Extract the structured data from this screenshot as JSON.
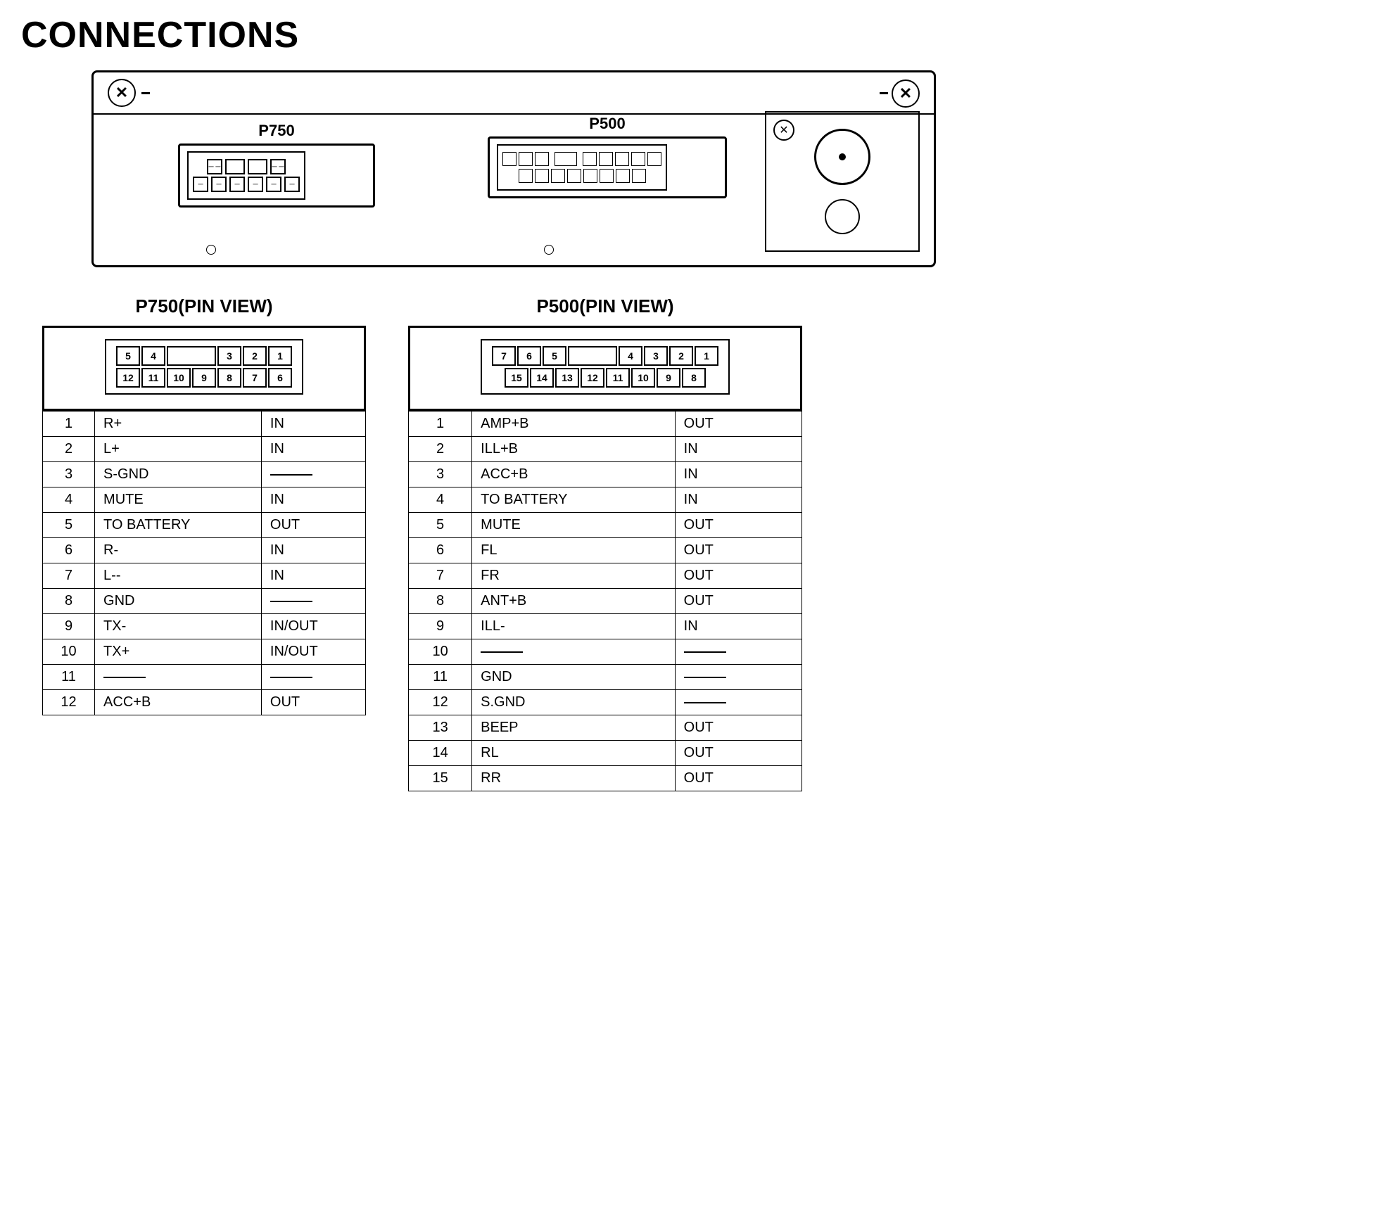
{
  "page": {
    "title": "CONNECTIONS"
  },
  "device": {
    "connector_p750_label": "P750",
    "connector_p500_label": "P500"
  },
  "p750_pin_view": {
    "title": "P750(PIN VIEW)",
    "row1": [
      "5",
      "4",
      "",
      "3",
      "2",
      "1"
    ],
    "row2": [
      "12",
      "11",
      "10",
      "9",
      "8",
      "7",
      "6"
    ]
  },
  "p500_pin_view": {
    "title": "P500(PIN VIEW)",
    "row1": [
      "7",
      "6",
      "5",
      "",
      "4",
      "3",
      "2",
      "1"
    ],
    "row2": [
      "15",
      "14",
      "13",
      "12",
      "11",
      "10",
      "9",
      "8"
    ]
  },
  "p750_pins": [
    {
      "pin": "1",
      "signal": "R+",
      "dir": "IN"
    },
    {
      "pin": "2",
      "signal": "L+",
      "dir": "IN"
    },
    {
      "pin": "3",
      "signal": "S-GND",
      "dir": "—"
    },
    {
      "pin": "4",
      "signal": "MUTE",
      "dir": "IN"
    },
    {
      "pin": "5",
      "signal": "TO BATTERY",
      "dir": "OUT"
    },
    {
      "pin": "6",
      "signal": "R-",
      "dir": "IN"
    },
    {
      "pin": "7",
      "signal": "L--",
      "dir": "IN"
    },
    {
      "pin": "8",
      "signal": "GND",
      "dir": "—"
    },
    {
      "pin": "9",
      "signal": "TX-",
      "dir": "IN/OUT"
    },
    {
      "pin": "10",
      "signal": "TX+",
      "dir": "IN/OUT"
    },
    {
      "pin": "11",
      "signal": "—",
      "dir": "—"
    },
    {
      "pin": "12",
      "signal": "ACC+B",
      "dir": "OUT"
    }
  ],
  "p500_pins": [
    {
      "pin": "1",
      "signal": "AMP+B",
      "dir": "OUT"
    },
    {
      "pin": "2",
      "signal": "ILL+B",
      "dir": "IN"
    },
    {
      "pin": "3",
      "signal": "ACC+B",
      "dir": "IN"
    },
    {
      "pin": "4",
      "signal": "TO BATTERY",
      "dir": "IN"
    },
    {
      "pin": "5",
      "signal": "MUTE",
      "dir": "OUT"
    },
    {
      "pin": "6",
      "signal": "FL",
      "dir": "OUT"
    },
    {
      "pin": "7",
      "signal": "FR",
      "dir": "OUT"
    },
    {
      "pin": "8",
      "signal": "ANT+B",
      "dir": "OUT"
    },
    {
      "pin": "9",
      "signal": "ILL-",
      "dir": "IN"
    },
    {
      "pin": "10",
      "signal": "—",
      "dir": "—"
    },
    {
      "pin": "11",
      "signal": "GND",
      "dir": "—"
    },
    {
      "pin": "12",
      "signal": "S.GND",
      "dir": "—"
    },
    {
      "pin": "13",
      "signal": "BEEP",
      "dir": "OUT"
    },
    {
      "pin": "14",
      "signal": "RL",
      "dir": "OUT"
    },
    {
      "pin": "15",
      "signal": "RR",
      "dir": "OUT"
    }
  ]
}
